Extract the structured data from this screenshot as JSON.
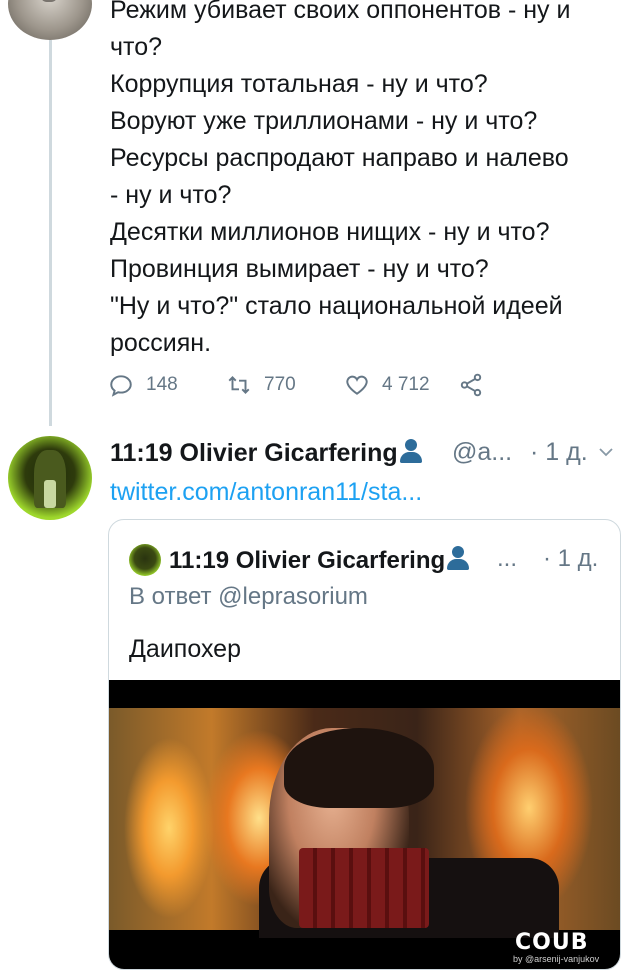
{
  "top_tweet": {
    "lines": [
      "Режим убивает своих оппонентов - ну и",
      "что?",
      "Коррупция тотальная - ну и что?",
      "Воруют уже триллионами - ну и что?",
      "Ресурсы распродают направо и налево",
      "- ну и что?",
      "Десятки миллионов нищих  - ну и что?",
      "Провинция вымирает - ну и что?",
      "\"Ну и что?\" стало национальной идеей",
      "россиян."
    ],
    "replies": "148",
    "retweets": "770",
    "likes": "4 712"
  },
  "tweet": {
    "time_name": "11:19 Olivier Gicarfering",
    "handle": "@a...",
    "ago": "· 1 д.",
    "link": "twitter.com/antonran11/sta..."
  },
  "quoted": {
    "time_name": "11:19 Olivier Gicarfering",
    "handle": "...",
    "ago": "· 1 д.",
    "reply_to": "В ответ @leprasorium",
    "text": "Даипохер",
    "media_logo": "COUB",
    "media_by": "by @arsenij-vanjukov"
  }
}
